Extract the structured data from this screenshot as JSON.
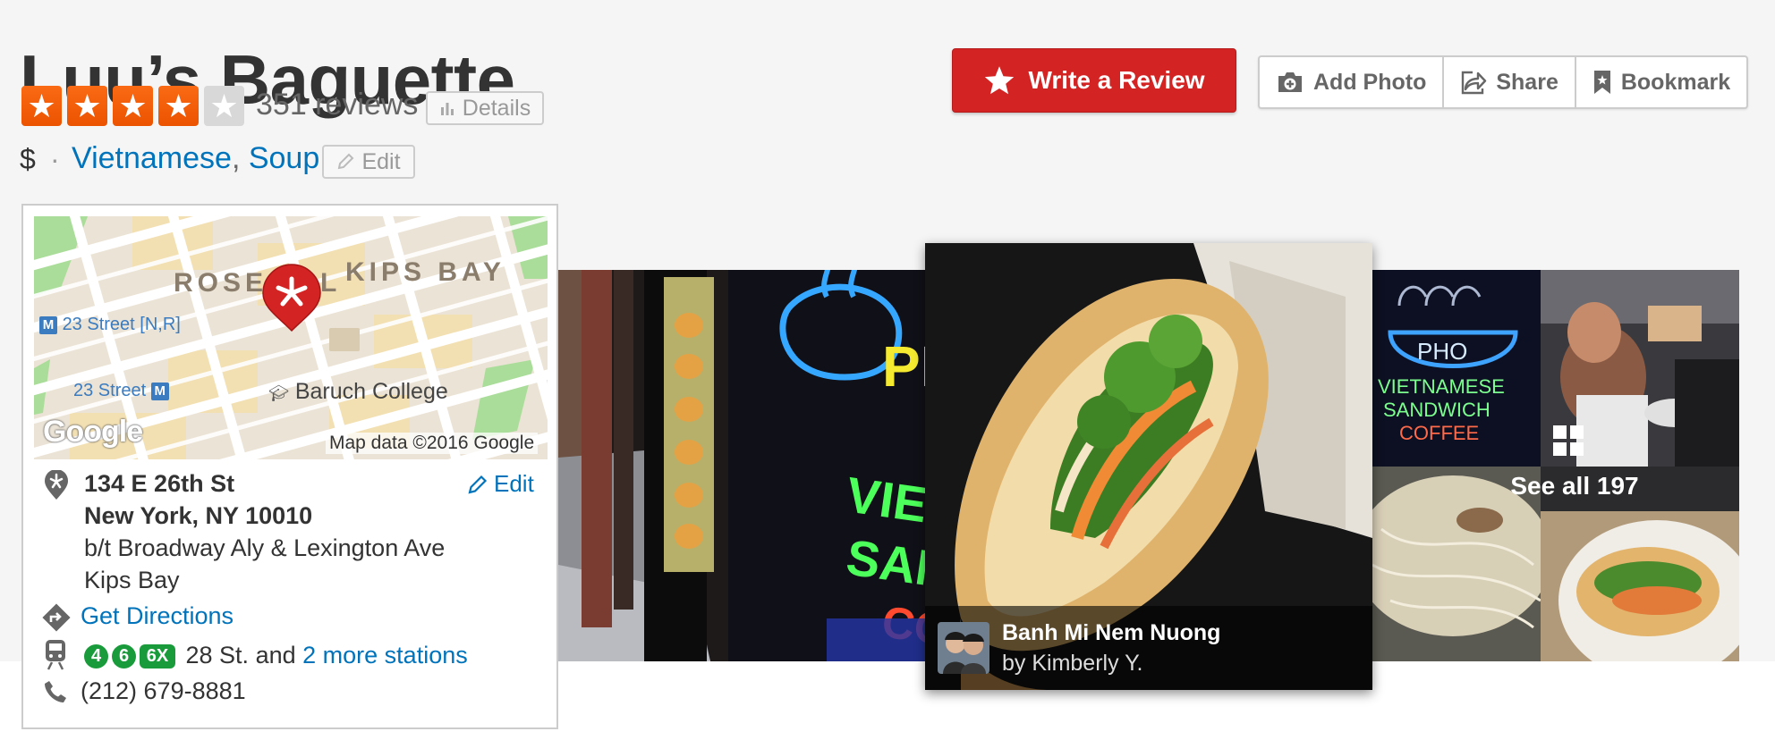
{
  "business": {
    "name": "Luu’s Baguette",
    "rating": 4,
    "rating_max": 5,
    "review_count": "351 reviews",
    "details_label": "Details",
    "price": "$",
    "categories": [
      "Vietnamese",
      "Soup"
    ],
    "category_separator": ",",
    "edit_label": "Edit"
  },
  "actions": {
    "write_review": "Write a Review",
    "add_photo": "Add Photo",
    "share": "Share",
    "bookmark": "Bookmark"
  },
  "map": {
    "area_label_1": "ROSE",
    "area_label_1b": "L",
    "area_label_2": "KIPS BAY",
    "station_1": "23 Street [N,R]",
    "station_2": "23 Street",
    "station_badge": "M",
    "college": "Baruch College",
    "google_logo": "Google",
    "attribution": "Map data ©2016 Google"
  },
  "address": {
    "street": "134 E 26th St",
    "city": "New York, NY 10010",
    "cross_streets": "b/t Broadway Aly & Lexington Ave",
    "neighborhood": "Kips Bay",
    "edit_label": "Edit",
    "directions_label": "Get Directions",
    "transit_lines": [
      "4",
      "6",
      "6X"
    ],
    "transit_text": "28 St. and",
    "transit_more": "2 more stations",
    "phone": "(212) 679-8881"
  },
  "photos": {
    "featured_title": "Banh Mi Nem Nuong",
    "featured_by": "by Kimberly Y.",
    "see_all": "See all 197",
    "neon_text_1": "PHO",
    "neon_text_2": "VIETNAMESE",
    "neon_text_3": "SANDWICH",
    "neon_text_4": "COFFEE"
  },
  "colors": {
    "brand_red": "#d32323",
    "star_orange": "#f15c00",
    "link_blue": "#0073bb",
    "transit_green": "#1a9b3b"
  }
}
